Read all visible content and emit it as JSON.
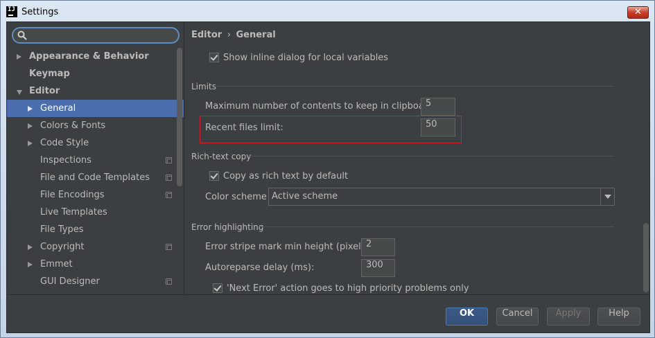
{
  "window": {
    "title": "Settings",
    "app_icon_text": "IJ",
    "close_glyph": "✕"
  },
  "search": {
    "value": "",
    "placeholder": ""
  },
  "tree": [
    {
      "label": "Appearance & Behavior",
      "bold": true,
      "arrow": "right",
      "indent": 0
    },
    {
      "label": "Keymap",
      "bold": true,
      "arrow": "none",
      "indent": 0
    },
    {
      "label": "Editor",
      "bold": true,
      "arrow": "down",
      "indent": 0
    },
    {
      "label": "General",
      "bold": false,
      "arrow": "right",
      "indent": 1,
      "selected": true
    },
    {
      "label": "Colors & Fonts",
      "bold": false,
      "arrow": "right",
      "indent": 1
    },
    {
      "label": "Code Style",
      "bold": false,
      "arrow": "right",
      "indent": 1
    },
    {
      "label": "Inspections",
      "bold": false,
      "arrow": "none",
      "indent": 1,
      "project_icon": true
    },
    {
      "label": "File and Code Templates",
      "bold": false,
      "arrow": "none",
      "indent": 1,
      "project_icon": true
    },
    {
      "label": "File Encodings",
      "bold": false,
      "arrow": "none",
      "indent": 1,
      "project_icon": true
    },
    {
      "label": "Live Templates",
      "bold": false,
      "arrow": "none",
      "indent": 1
    },
    {
      "label": "File Types",
      "bold": false,
      "arrow": "none",
      "indent": 1
    },
    {
      "label": "Copyright",
      "bold": false,
      "arrow": "right",
      "indent": 1,
      "project_icon": true
    },
    {
      "label": "Emmet",
      "bold": false,
      "arrow": "right",
      "indent": 1
    },
    {
      "label": "GUI Designer",
      "bold": false,
      "arrow": "none",
      "indent": 1,
      "project_icon": true
    }
  ],
  "breadcrumb": {
    "part1": "Editor",
    "sep": "›",
    "part2": "General"
  },
  "content": {
    "inline_dialog": {
      "label": "Show inline dialog for local variables",
      "checked": true
    },
    "limits": {
      "title": "Limits",
      "clipboard_label": "Maximum number of contents to keep in clipboard:",
      "clipboard_value": "5",
      "recent_label": "Recent files limit:",
      "recent_value": "50"
    },
    "rich_text": {
      "title": "Rich-text copy",
      "copy_label": "Copy as rich text by default",
      "copy_checked": true,
      "scheme_label": "Color scheme",
      "scheme_value": "Active scheme"
    },
    "error": {
      "title": "Error highlighting",
      "stripe_label": "Error stripe mark min height (pixels):",
      "stripe_value": "2",
      "reparse_label": "Autoreparse delay (ms):",
      "reparse_value": "300",
      "next_error_label": "'Next Error' action goes to high priority problems only",
      "next_error_checked": true
    }
  },
  "buttons": {
    "ok": "OK",
    "cancel": "Cancel",
    "apply": "Apply",
    "help": "Help"
  },
  "colors": {
    "background": "#3c3f41",
    "selection": "#4b6eaf",
    "highlight_box": "#d0202a",
    "default_button": "#365880"
  }
}
